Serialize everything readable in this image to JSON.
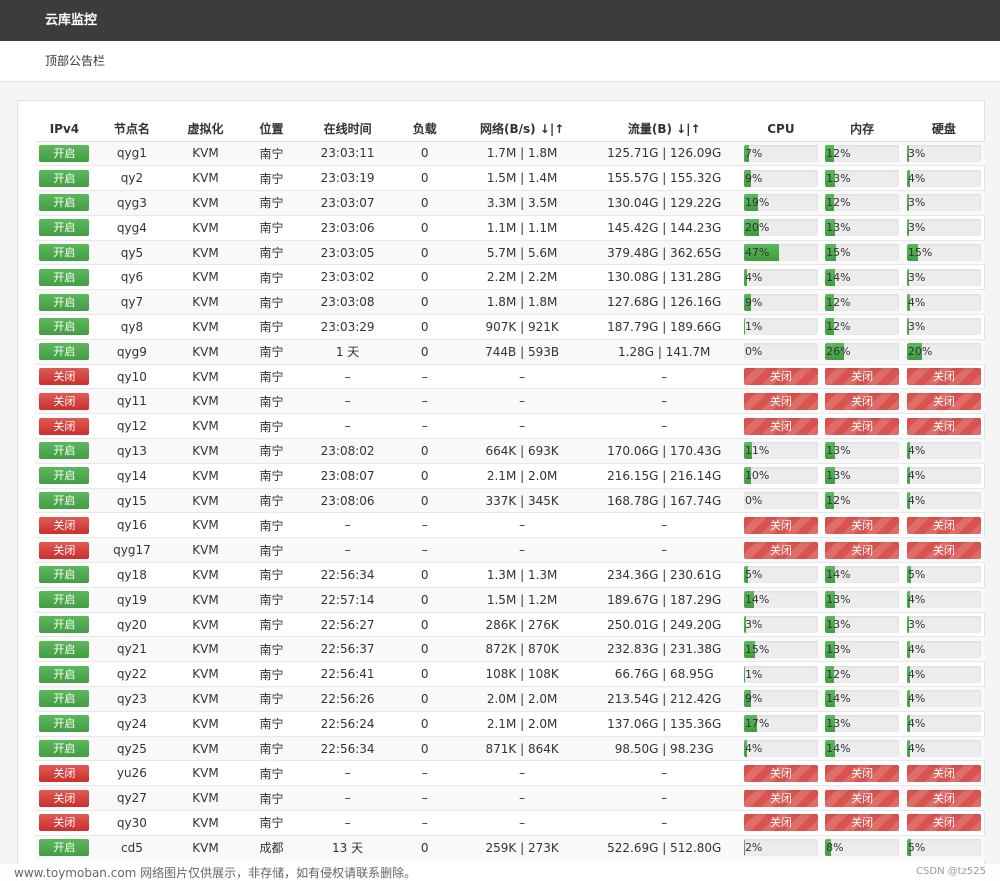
{
  "header": {
    "title": "云库监控"
  },
  "notice": {
    "text": "顶部公告栏"
  },
  "table": {
    "columns": [
      "IPv4",
      "节点名",
      "虚拟化",
      "位置",
      "在线时间",
      "负载",
      "网络(B/s) ↓|↑",
      "流量(B) ↓|↑",
      "CPU",
      "内存",
      "硬盘"
    ],
    "on_label": "开启",
    "off_label": "关闭",
    "rows": [
      {
        "on": true,
        "name": "qyg1",
        "virt": "KVM",
        "loc": "南宁",
        "uptime": "23:03:11",
        "load": "0",
        "net": "1.7M | 1.8M",
        "traffic": "125.71G | 126.09G",
        "cpu": 7,
        "mem": 12,
        "disk": 3
      },
      {
        "on": true,
        "name": "qy2",
        "virt": "KVM",
        "loc": "南宁",
        "uptime": "23:03:19",
        "load": "0",
        "net": "1.5M | 1.4M",
        "traffic": "155.57G | 155.32G",
        "cpu": 9,
        "mem": 13,
        "disk": 4
      },
      {
        "on": true,
        "name": "qyg3",
        "virt": "KVM",
        "loc": "南宁",
        "uptime": "23:03:07",
        "load": "0",
        "net": "3.3M | 3.5M",
        "traffic": "130.04G | 129.22G",
        "cpu": 19,
        "mem": 12,
        "disk": 3
      },
      {
        "on": true,
        "name": "qyg4",
        "virt": "KVM",
        "loc": "南宁",
        "uptime": "23:03:06",
        "load": "0",
        "net": "1.1M | 1.1M",
        "traffic": "145.42G | 144.23G",
        "cpu": 20,
        "mem": 13,
        "disk": 3
      },
      {
        "on": true,
        "name": "qy5",
        "virt": "KVM",
        "loc": "南宁",
        "uptime": "23:03:05",
        "load": "0",
        "net": "5.7M | 5.6M",
        "traffic": "379.48G | 362.65G",
        "cpu": 47,
        "mem": 15,
        "disk": 15
      },
      {
        "on": true,
        "name": "qy6",
        "virt": "KVM",
        "loc": "南宁",
        "uptime": "23:03:02",
        "load": "0",
        "net": "2.2M | 2.2M",
        "traffic": "130.08G | 131.28G",
        "cpu": 4,
        "mem": 14,
        "disk": 3
      },
      {
        "on": true,
        "name": "qy7",
        "virt": "KVM",
        "loc": "南宁",
        "uptime": "23:03:08",
        "load": "0",
        "net": "1.8M | 1.8M",
        "traffic": "127.68G | 126.16G",
        "cpu": 9,
        "mem": 12,
        "disk": 4
      },
      {
        "on": true,
        "name": "qy8",
        "virt": "KVM",
        "loc": "南宁",
        "uptime": "23:03:29",
        "load": "0",
        "net": "907K | 921K",
        "traffic": "187.79G | 189.66G",
        "cpu": 1,
        "mem": 12,
        "disk": 3
      },
      {
        "on": true,
        "name": "qyg9",
        "virt": "KVM",
        "loc": "南宁",
        "uptime": "1 天",
        "load": "0",
        "net": "744B | 593B",
        "traffic": "1.28G | 141.7M",
        "cpu": 0,
        "mem": 26,
        "disk": 20
      },
      {
        "on": false,
        "name": "qy10",
        "virt": "KVM",
        "loc": "南宁",
        "uptime": "–",
        "load": "–",
        "net": "–",
        "traffic": "–"
      },
      {
        "on": false,
        "name": "qy11",
        "virt": "KVM",
        "loc": "南宁",
        "uptime": "–",
        "load": "–",
        "net": "–",
        "traffic": "–"
      },
      {
        "on": false,
        "name": "qy12",
        "virt": "KVM",
        "loc": "南宁",
        "uptime": "–",
        "load": "–",
        "net": "–",
        "traffic": "–"
      },
      {
        "on": true,
        "name": "qy13",
        "virt": "KVM",
        "loc": "南宁",
        "uptime": "23:08:02",
        "load": "0",
        "net": "664K | 693K",
        "traffic": "170.06G | 170.43G",
        "cpu": 11,
        "mem": 13,
        "disk": 4
      },
      {
        "on": true,
        "name": "qy14",
        "virt": "KVM",
        "loc": "南宁",
        "uptime": "23:08:07",
        "load": "0",
        "net": "2.1M | 2.0M",
        "traffic": "216.15G | 216.14G",
        "cpu": 10,
        "mem": 13,
        "disk": 4
      },
      {
        "on": true,
        "name": "qy15",
        "virt": "KVM",
        "loc": "南宁",
        "uptime": "23:08:06",
        "load": "0",
        "net": "337K | 345K",
        "traffic": "168.78G | 167.74G",
        "cpu": 0,
        "mem": 12,
        "disk": 4
      },
      {
        "on": false,
        "name": "qy16",
        "virt": "KVM",
        "loc": "南宁",
        "uptime": "–",
        "load": "–",
        "net": "–",
        "traffic": "–"
      },
      {
        "on": false,
        "name": "qyg17",
        "virt": "KVM",
        "loc": "南宁",
        "uptime": "–",
        "load": "–",
        "net": "–",
        "traffic": "–"
      },
      {
        "on": true,
        "name": "qy18",
        "virt": "KVM",
        "loc": "南宁",
        "uptime": "22:56:34",
        "load": "0",
        "net": "1.3M | 1.3M",
        "traffic": "234.36G | 230.61G",
        "cpu": 5,
        "mem": 14,
        "disk": 5
      },
      {
        "on": true,
        "name": "qy19",
        "virt": "KVM",
        "loc": "南宁",
        "uptime": "22:57:14",
        "load": "0",
        "net": "1.5M | 1.2M",
        "traffic": "189.67G | 187.29G",
        "cpu": 14,
        "mem": 13,
        "disk": 4
      },
      {
        "on": true,
        "name": "qy20",
        "virt": "KVM",
        "loc": "南宁",
        "uptime": "22:56:27",
        "load": "0",
        "net": "286K | 276K",
        "traffic": "250.01G | 249.20G",
        "cpu": 3,
        "mem": 13,
        "disk": 3
      },
      {
        "on": true,
        "name": "qy21",
        "virt": "KVM",
        "loc": "南宁",
        "uptime": "22:56:37",
        "load": "0",
        "net": "872K | 870K",
        "traffic": "232.83G | 231.38G",
        "cpu": 15,
        "mem": 13,
        "disk": 4
      },
      {
        "on": true,
        "name": "qy22",
        "virt": "KVM",
        "loc": "南宁",
        "uptime": "22:56:41",
        "load": "0",
        "net": "108K | 108K",
        "traffic": "66.76G | 68.95G",
        "cpu": 1,
        "mem": 12,
        "disk": 4
      },
      {
        "on": true,
        "name": "qy23",
        "virt": "KVM",
        "loc": "南宁",
        "uptime": "22:56:26",
        "load": "0",
        "net": "2.0M | 2.0M",
        "traffic": "213.54G | 212.42G",
        "cpu": 9,
        "mem": 14,
        "disk": 4
      },
      {
        "on": true,
        "name": "qy24",
        "virt": "KVM",
        "loc": "南宁",
        "uptime": "22:56:24",
        "load": "0",
        "net": "2.1M | 2.0M",
        "traffic": "137.06G | 135.36G",
        "cpu": 17,
        "mem": 13,
        "disk": 4
      },
      {
        "on": true,
        "name": "qy25",
        "virt": "KVM",
        "loc": "南宁",
        "uptime": "22:56:34",
        "load": "0",
        "net": "871K | 864K",
        "traffic": "98.50G | 98.23G",
        "cpu": 4,
        "mem": 14,
        "disk": 4
      },
      {
        "on": false,
        "name": "yu26",
        "virt": "KVM",
        "loc": "南宁",
        "uptime": "–",
        "load": "–",
        "net": "–",
        "traffic": "–"
      },
      {
        "on": false,
        "name": "qy27",
        "virt": "KVM",
        "loc": "南宁",
        "uptime": "–",
        "load": "–",
        "net": "–",
        "traffic": "–"
      },
      {
        "on": false,
        "name": "qy30",
        "virt": "KVM",
        "loc": "南宁",
        "uptime": "–",
        "load": "–",
        "net": "–",
        "traffic": "–"
      },
      {
        "on": true,
        "name": "cd5",
        "virt": "KVM",
        "loc": "成都",
        "uptime": "13 天",
        "load": "0",
        "net": "259K | 273K",
        "traffic": "522.69G | 512.80G",
        "cpu": 2,
        "mem": 8,
        "disk": 5
      }
    ]
  },
  "watermark": {
    "left": "www.toymoban.com 网络图片仅供展示，非存储，如有侵权请联系删除。",
    "right": "CSDN @tz525"
  },
  "colors": {
    "on": "#5cb85c",
    "off": "#d9534f",
    "topbar": "#3c3c3c"
  }
}
